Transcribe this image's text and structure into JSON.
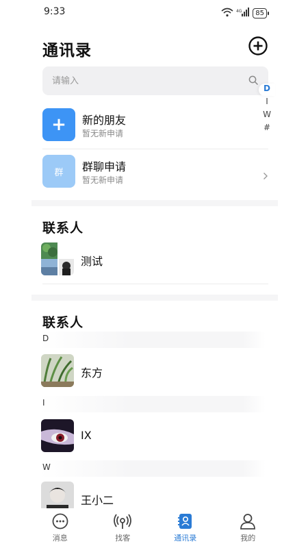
{
  "status_bar": {
    "time": "9:33",
    "battery": "85"
  },
  "header": {
    "title": "通讯录"
  },
  "search": {
    "placeholder": "请输入"
  },
  "alpha_index": [
    "D",
    "I",
    "W",
    "#"
  ],
  "functions": [
    {
      "title": "新的朋友",
      "subtitle": "暂无新申请",
      "icon_text": "+"
    },
    {
      "title": "群聊申请",
      "subtitle": "暂无新申请",
      "icon_text": "群"
    }
  ],
  "groups_section": {
    "title": "联系人",
    "items": [
      {
        "name": "测试"
      }
    ]
  },
  "contacts_section": {
    "title": "联系人",
    "groups": [
      {
        "letter": "D",
        "contacts": [
          {
            "name": "东方"
          }
        ]
      },
      {
        "letter": "I",
        "contacts": [
          {
            "name": "IX"
          }
        ]
      },
      {
        "letter": "W",
        "contacts": [
          {
            "name": "王小二"
          }
        ]
      }
    ]
  },
  "tabbar": {
    "items": [
      {
        "label": "消息",
        "icon": "chat-icon"
      },
      {
        "label": "找客",
        "icon": "radar-icon"
      },
      {
        "label": "通讯录",
        "icon": "contacts-icon",
        "active": true
      },
      {
        "label": "我的",
        "icon": "person-icon"
      }
    ]
  },
  "colors": {
    "accent": "#2a7bd5",
    "new_friend_tile": "#3d94f5",
    "group_tile": "#9ccaf7"
  }
}
